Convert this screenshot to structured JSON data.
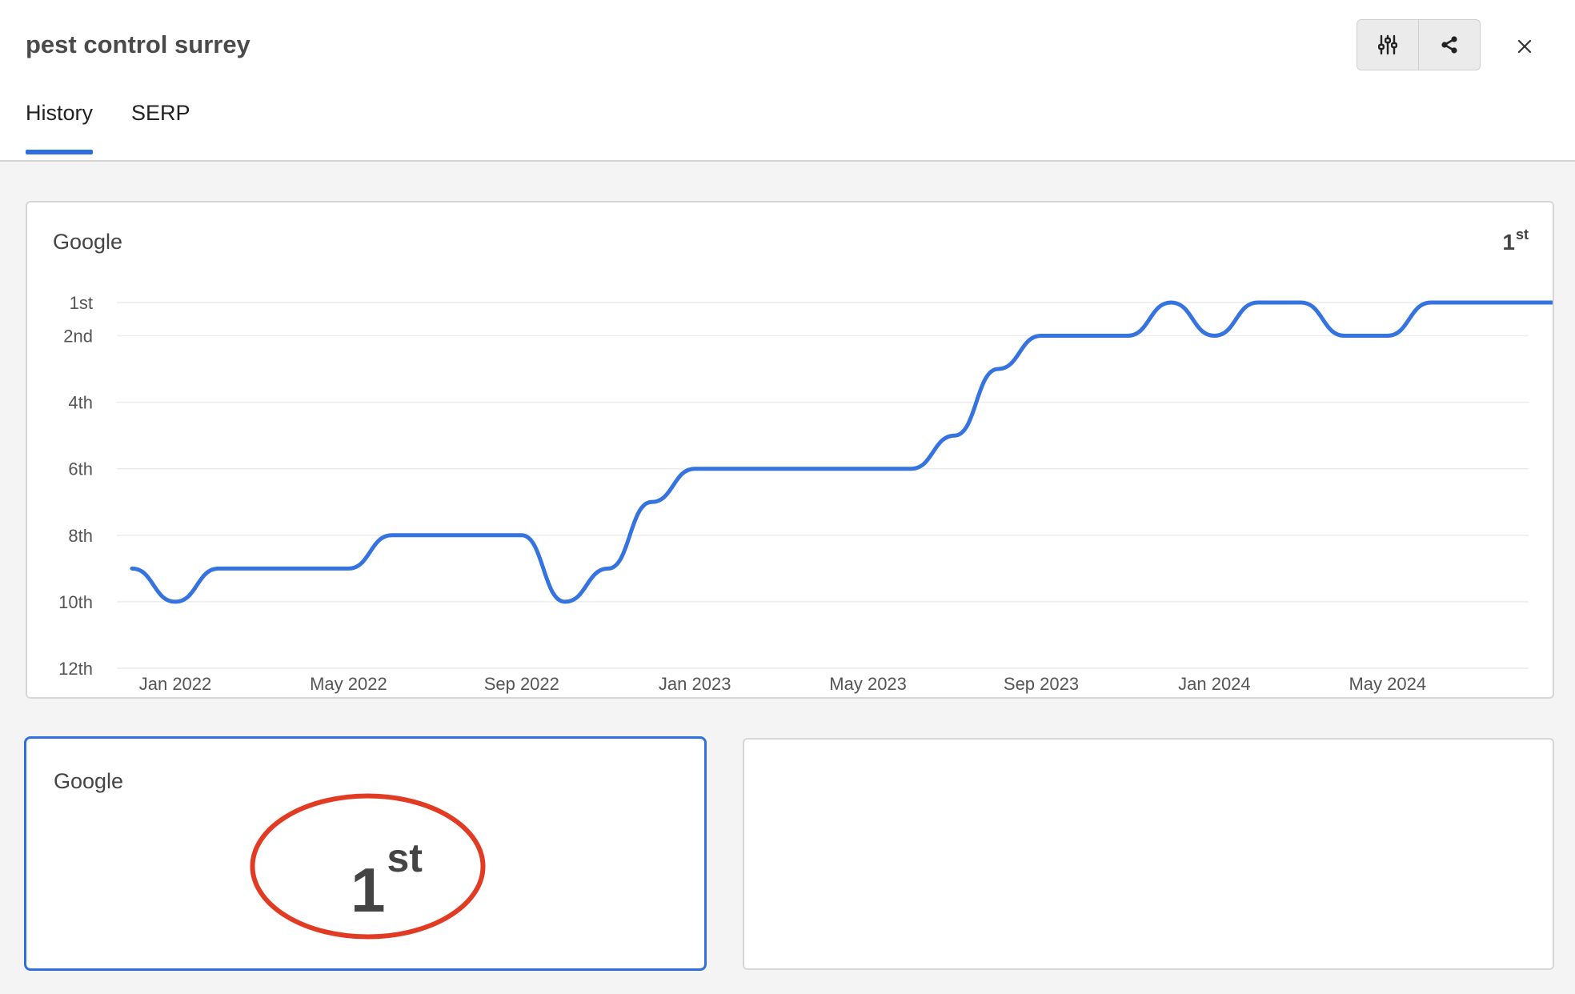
{
  "header": {
    "title": "pest control surrey",
    "tabs": [
      {
        "label": "History",
        "active": true
      },
      {
        "label": "SERP",
        "active": false
      }
    ]
  },
  "toolbar": {
    "filter_icon": "sliders-icon",
    "share_icon": "share-icon",
    "close_icon": "close-icon"
  },
  "history_card": {
    "engine": "Google",
    "current_rank": {
      "num": "1",
      "suffix": "st"
    }
  },
  "rank_card": {
    "engine": "Google",
    "rank": {
      "num": "1",
      "suffix": "st"
    },
    "highlight_color": "#e23b24"
  },
  "colors": {
    "accent": "#2f6fe0",
    "line": "#3573e0"
  },
  "chart_data": {
    "type": "line",
    "yaxis": {
      "inverted": true,
      "ticks": [
        {
          "value": 1,
          "label": "1st"
        },
        {
          "value": 2,
          "label": "2nd"
        },
        {
          "value": 4,
          "label": "4th"
        },
        {
          "value": 6,
          "label": "6th"
        },
        {
          "value": 8,
          "label": "8th"
        },
        {
          "value": 10,
          "label": "10th"
        },
        {
          "value": 12,
          "label": "12th"
        }
      ],
      "ylim": [
        1,
        12
      ]
    },
    "xaxis": {
      "ticks": [
        "Jan 2022",
        "May 2022",
        "Sep 2022",
        "Jan 2023",
        "May 2023",
        "Sep 2023",
        "Jan 2024",
        "May 2024"
      ]
    },
    "grid": true,
    "series": [
      {
        "values": [
          [
            "2021-12-01",
            9
          ],
          [
            "2022-01-01",
            10
          ],
          [
            "2022-02-01",
            9
          ],
          [
            "2022-03-01",
            9
          ],
          [
            "2022-04-01",
            9
          ],
          [
            "2022-05-01",
            9
          ],
          [
            "2022-06-01",
            8
          ],
          [
            "2022-07-01",
            8
          ],
          [
            "2022-08-01",
            8
          ],
          [
            "2022-09-01",
            8
          ],
          [
            "2022-10-01",
            10
          ],
          [
            "2022-11-01",
            9
          ],
          [
            "2022-12-01",
            7
          ],
          [
            "2023-01-01",
            6
          ],
          [
            "2023-02-01",
            6
          ],
          [
            "2023-03-01",
            6
          ],
          [
            "2023-04-01",
            6
          ],
          [
            "2023-05-01",
            6
          ],
          [
            "2023-06-01",
            6
          ],
          [
            "2023-07-01",
            5
          ],
          [
            "2023-08-01",
            3
          ],
          [
            "2023-09-01",
            2
          ],
          [
            "2023-10-01",
            2
          ],
          [
            "2023-11-01",
            2
          ],
          [
            "2023-12-01",
            1
          ],
          [
            "2024-01-01",
            2
          ],
          [
            "2024-02-01",
            1
          ],
          [
            "2024-03-01",
            1
          ],
          [
            "2024-04-01",
            2
          ],
          [
            "2024-05-01",
            2
          ],
          [
            "2024-06-01",
            1
          ],
          [
            "2024-07-01",
            1
          ],
          [
            "2024-08-01",
            1
          ],
          [
            "2024-09-01",
            1
          ]
        ]
      }
    ]
  }
}
